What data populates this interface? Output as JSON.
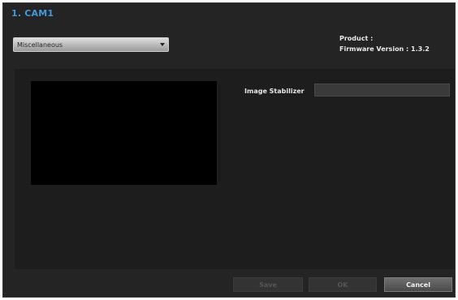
{
  "dialog": {
    "title": "1. CAM1"
  },
  "menu": {
    "selected": "Miscellaneous"
  },
  "info": {
    "product_label": "Product :",
    "firmware_label": "Firmware Version : 1.3.2"
  },
  "settings": {
    "stabilizer_label": "Image Stabilizer",
    "stabilizer_value": ""
  },
  "buttons": {
    "apply": "Save",
    "ok": "OK",
    "cancel": "Cancel"
  }
}
